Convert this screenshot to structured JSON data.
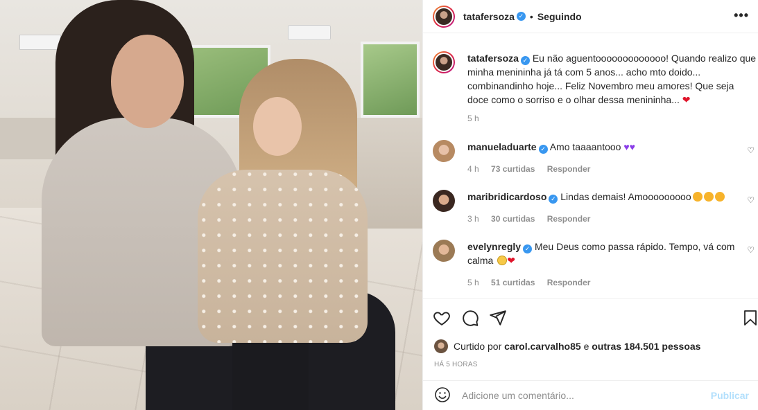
{
  "post": {
    "image_alt": "Mãe e filha sorrindo em sala de estar"
  },
  "header": {
    "username": "tatafersoza",
    "dot": "•",
    "follow_status": "Seguindo",
    "more": "•••"
  },
  "caption": {
    "username": "tatafersoza",
    "text": "Eu não aguentooooooooooooo! Quando realizo que minha menininha já tá com 5 anos... acho mto doido... combinandinho hoje... Feliz Novembro meu amores! Que seja doce como o sorriso e o olhar dessa menininha...",
    "time": "5 h"
  },
  "comments": [
    {
      "username": "manueladuarte",
      "text": "Amo taaaantooo",
      "emoji": [
        "purple-heart",
        "purple-heart"
      ],
      "time": "4 h",
      "likes": "73 curtidas",
      "reply": "Responder"
    },
    {
      "username": "maribridicardoso",
      "text": "Lindas demais! Amooooooooo",
      "emoji": [
        "star-eyes",
        "star-eyes",
        "star-eyes"
      ],
      "time": "3 h",
      "likes": "30 curtidas",
      "reply": "Responder"
    },
    {
      "username": "evelynregly",
      "text": "Meu Deus como passa rápido. Tempo, vá com calma",
      "emoji": [
        "sad-face",
        "red-heart"
      ],
      "time": "5 h",
      "likes": "51 curtidas",
      "reply": "Responder"
    }
  ],
  "actions": {
    "icons": [
      "heart-icon",
      "comment-icon",
      "share-icon",
      "bookmark-icon"
    ]
  },
  "likes": {
    "prefix": "Curtido por",
    "user": "carol.carvalho85",
    "middle": "e",
    "others": "outras 184.501 pessoas"
  },
  "posted_ago": "HÁ 5 HORAS",
  "add_comment": {
    "placeholder": "Adicione um comentário...",
    "publish": "Publicar"
  },
  "colors": {
    "verified": "#3897f0",
    "text": "#262626",
    "muted": "#8e8e8e",
    "publish_disabled": "#b2dffc",
    "heart_red": "#e0152b",
    "heart_purple": "#8a3ee8"
  }
}
